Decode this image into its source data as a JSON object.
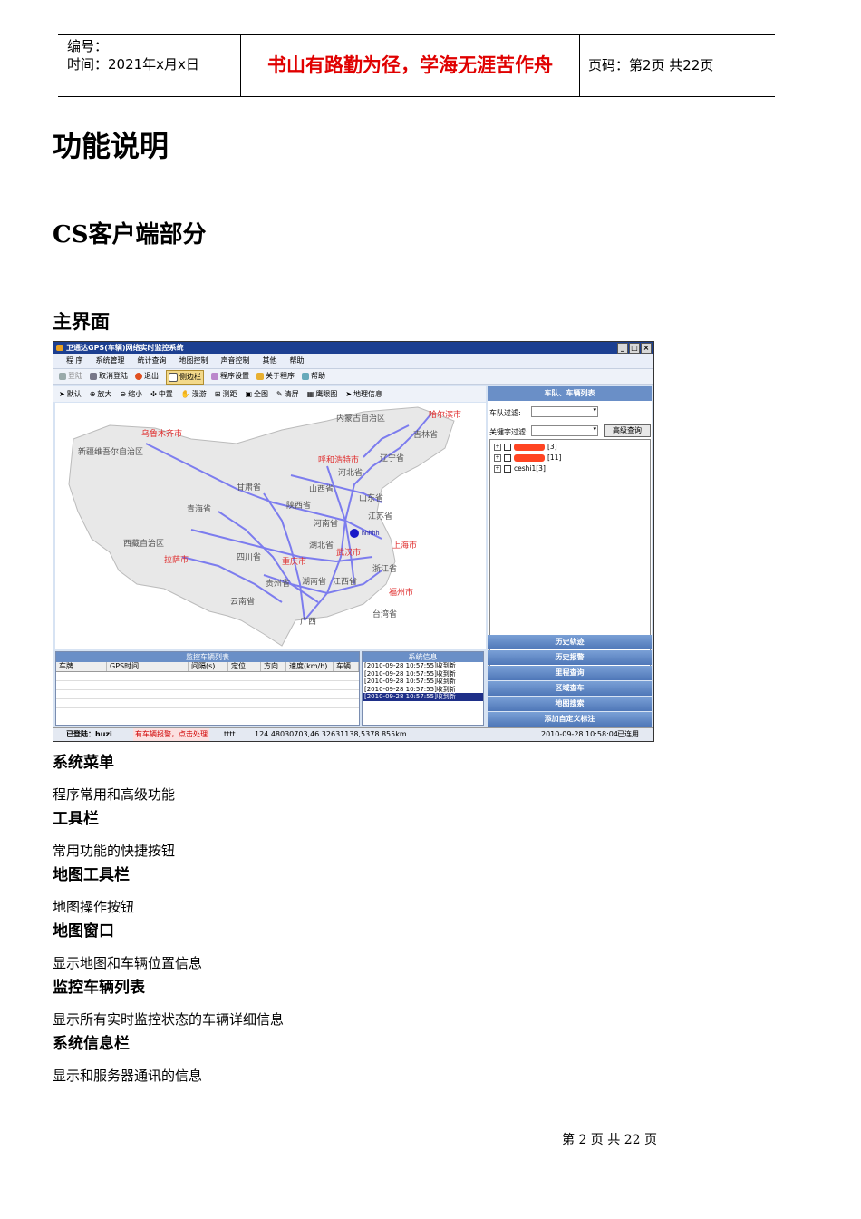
{
  "header": {
    "number_label": "编号：",
    "time_label": "时间：2021年x月x日",
    "motto": "书山有路勤为径，学海无涯苦作舟",
    "page_label": "页码：第2页  共22页"
  },
  "headings": {
    "h1": "功能说明",
    "h2": "CS客户端部分",
    "h3": "主界面"
  },
  "screenshot": {
    "window_title": "卫通达GPS(车辆)网络实时监控系统",
    "menu": [
      "程 序",
      "系统管理",
      "统计查询",
      "地图控制",
      "声音控制",
      "其他",
      "帮助"
    ],
    "toolbar": [
      "登陆",
      "取消登陆",
      "退出",
      "侧边栏",
      "程序设置",
      "关于程序",
      "帮助"
    ],
    "map_toolbar": [
      "默认",
      "放大",
      "缩小",
      "中置",
      "漫游",
      "测距",
      "全图",
      "清屏",
      "鹰眼图",
      "地理信息"
    ],
    "map_labels": [
      "内蒙古自治区",
      "哈尔滨市",
      "乌鲁木齐市",
      "新疆维吾尔自治区",
      "吉林省",
      "呼和浩特市",
      "辽宁省",
      "河北省",
      "甘肃省",
      "山西省",
      "山东省",
      "青海省",
      "陕西省",
      "河南省",
      "江苏省",
      "西藏自治区",
      "湖北省",
      "武汉市",
      "上海市",
      "拉萨市",
      "四川省",
      "重庆市",
      "浙江省",
      "贵州省",
      "湖南省",
      "江西省",
      "福州市",
      "云南省",
      "广西",
      "台湾省",
      "hhhhh"
    ],
    "right_panel": {
      "title": "车队、车辆列表",
      "fleet_filter_label": "车队过滤:",
      "keyword_filter_label": "关键字过滤:",
      "advanced_query": "高级查询",
      "tree": [
        {
          "label": "[3]"
        },
        {
          "label": "[11]"
        },
        {
          "label": "ceshi1[3]"
        }
      ]
    },
    "nav_buttons": [
      "历史轨迹",
      "历史报警",
      "里程查询",
      "区域查车",
      "地图搜索",
      "添加自定义标注"
    ],
    "monitor": {
      "title": "监控车辆列表",
      "columns": [
        "车牌",
        "GPS时间",
        "间隔(s)",
        "定位",
        "方向",
        "速度(km/h)",
        "车辆"
      ]
    },
    "sysinfo": {
      "title": "系统信息",
      "rows": [
        "[2010-09-28 10:57:55]收到新",
        "[2010-09-28 10:57:55]收到新",
        "[2010-09-28 10:57:55]收到新",
        "[2010-09-28 10:57:55]收到新",
        "[2010-09-28 10:57:55]收到新"
      ]
    },
    "statusbar": {
      "logged": "已登陆：huzi",
      "alarm": "有车辆报警，点击处理",
      "tttt": "tttt",
      "coords": "124.48030703,46.32631138,5378.855km",
      "datetime": "2010-09-28 10:58:04",
      "state": "已连用"
    }
  },
  "sections": [
    {
      "title": "系统菜单",
      "text": "程序常用和高级功能"
    },
    {
      "title": "工具栏",
      "text": "常用功能的快捷按钮"
    },
    {
      "title": "地图工具栏",
      "text": "地图操作按钮"
    },
    {
      "title": "地图窗口",
      "text": "显示地图和车辆位置信息"
    },
    {
      "title": "监控车辆列表",
      "text": "显示所有实时监控状态的车辆详细信息"
    },
    {
      "title": "系统信息栏",
      "text": "显示和服务器通讯的信息"
    }
  ],
  "footer": "第 2 页 共 22 页",
  "colors": {
    "motto": "#e00000",
    "titlebar": "#1c3f91",
    "panel_head": "#6a8fc7",
    "road": "#6a6af0",
    "city": "#e03030"
  }
}
